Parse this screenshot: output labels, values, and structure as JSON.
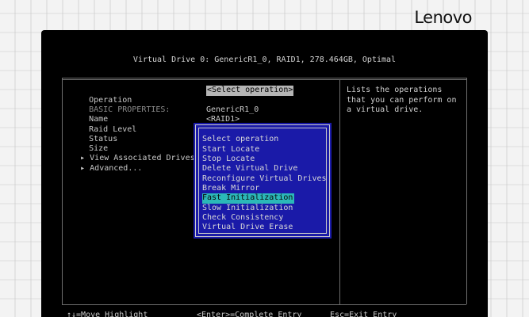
{
  "brand": {
    "logo": "Lenovo"
  },
  "screen": {
    "title": "Virtual Drive 0: GenericR1_0, RAID1, 278.464GB, Optimal",
    "labels": [
      {
        "text": "Operation",
        "dim": false,
        "marker": ""
      },
      {
        "text": "BASIC PROPERTIES:",
        "dim": true,
        "marker": ""
      },
      {
        "text": "Name",
        "dim": false,
        "marker": ""
      },
      {
        "text": "Raid Level",
        "dim": false,
        "marker": ""
      },
      {
        "text": "Status",
        "dim": false,
        "marker": ""
      },
      {
        "text": "Size",
        "dim": false,
        "marker": ""
      },
      {
        "text": "View Associated Drives",
        "dim": false,
        "marker": "▸"
      },
      {
        "text": "Advanced...",
        "dim": false,
        "marker": "▸"
      }
    ],
    "values": {
      "operation": "<Select operation>",
      "name": "GenericR1_0",
      "raid_level": "<RAID1>"
    },
    "help_text": "Lists the operations that you can perform on a virtual drive.",
    "popup": {
      "items": [
        "Select operation",
        "Start Locate",
        "Stop Locate",
        "Delete Virtual Drive",
        "Reconfigure Virtual Drives",
        "Break Mirror",
        "Fast Initialization",
        "Slow Initialization",
        "Check Consistency",
        "Virtual Drive Erase"
      ],
      "highlighted_index": 6
    },
    "footer": {
      "move": "↑↓=Move Highlight",
      "enter": "<Enter>=Complete Entry",
      "esc": "Esc=Exit Entry"
    }
  }
}
